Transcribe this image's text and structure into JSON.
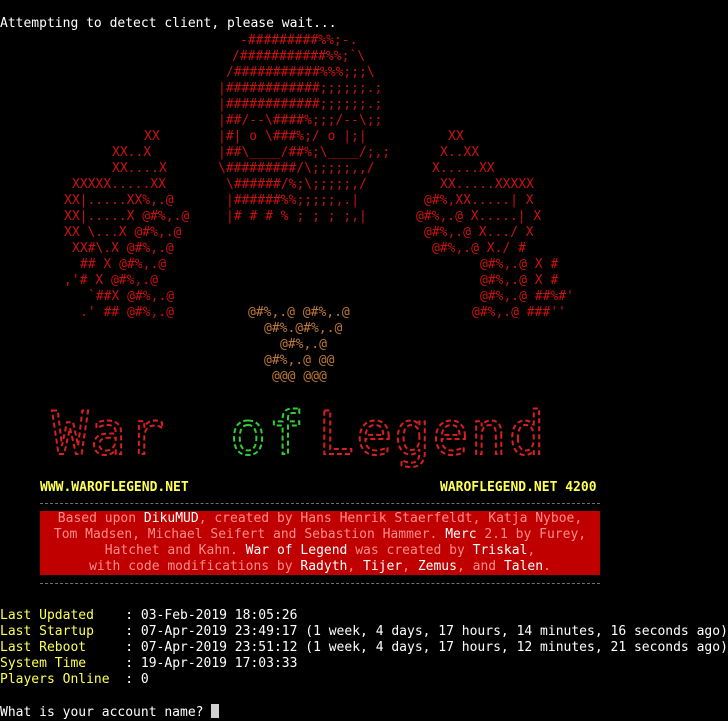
{
  "header_line": "Attempting to detect client, please wait...",
  "art": {
    "skull_lines": [
      "-#########%%;-.",
      "/###########%%;`\\",
      "/###########%%%;;;\\",
      "|############;;;;;;.;",
      "|############;;;;;;.;",
      "|##/--\\####%;;;/--\\;;",
      "|#|  o  \\###%;/ o  |;|",
      "|##\\____/##%;\\____/;,;",
      "\\#########/\\;;;;;,,/",
      "\\######/%;\\;;;;;,/",
      "|######%%;;;;;,.|",
      "|# # # % ; ; ; ;,|"
    ],
    "left_x": [
      "XX",
      "XX..X",
      "XX....X",
      "XXXXX.....XX",
      "XX|.....XX%,.@",
      "XX|.....X  @#%,.@",
      "XX \\...X     @#%,.@",
      "XX#\\.X        @#%,.@",
      "## X            @#%,.@",
      ",'# X            @#%,.@",
      "`##X              @#%,.@",
      ".' ##             @#%,.@"
    ],
    "right_x": [
      "XX",
      "X..XX",
      "X.....XX",
      "XX.....XXXXX",
      "@#%,XX.....| X",
      "@#%,.@  X.....| X",
      "@#%,.@     X.../  X",
      "@#%,.@       X./  #",
      "@#%,.@          X  #",
      "@#%,.@           X  #",
      "@#%,.@           ##%#'",
      "@#%,.@            ###''"
    ],
    "cross_lines": [
      "@#%,.@  @#%,.@",
      "@#%.@#%,.@",
      "@#%,.@",
      "@#%,.@  @@",
      "@@@  @@@"
    ]
  },
  "logo": {
    "text": "War of Legend",
    "colors": {
      "war": "#d82020",
      "of": "#33cc33",
      "legend": "#d82020"
    }
  },
  "urls": {
    "left": "WWW.WAROFLEGEND.NET",
    "right": "WAROFLEGEND.NET 4200"
  },
  "credits": {
    "l1_a": "Based upon ",
    "l1_b": "DikuMUD",
    "l1_c": ", created by Hans Henrik Staerfeldt, Katja Nyboe,",
    "l2_a": "Tom Madsen, Michael Seifert and Sebastion Hammer. ",
    "l2_b": "Merc",
    "l2_c": " 2.1 by Furey,",
    "l3_a": "Hatchet and Kahn. ",
    "l3_b": "War of Legend",
    "l3_c": " was created by ",
    "l3_d": "Triskal",
    "l3_e": ",",
    "l4_a": "with code modifications by ",
    "l4_b": "Radyth",
    "l4_c": ", ",
    "l4_d": "Tijer",
    "l4_e": ", ",
    "l4_f": "Zemus",
    "l4_g": ", and ",
    "l4_h": "Talen",
    "l4_i": "."
  },
  "status": [
    {
      "key": "Last Updated  ",
      "sep": ": ",
      "value": "03-Feb-2019 18:05:26"
    },
    {
      "key": "Last Startup  ",
      "sep": ": ",
      "value": "07-Apr-2019 23:49:17 (1 week, 4 days, 17 hours, 14 minutes, 16 seconds ago)"
    },
    {
      "key": "Last Reboot   ",
      "sep": ": ",
      "value": "07-Apr-2019 23:51:12 (1 week, 4 days, 17 hours, 12 minutes, 21 seconds ago)"
    },
    {
      "key": "System Time   ",
      "sep": ": ",
      "value": "19-Apr-2019 17:03:33"
    },
    {
      "key": "Players Online",
      "sep": ": ",
      "value": "0"
    }
  ],
  "prompt": "What is your account name?"
}
